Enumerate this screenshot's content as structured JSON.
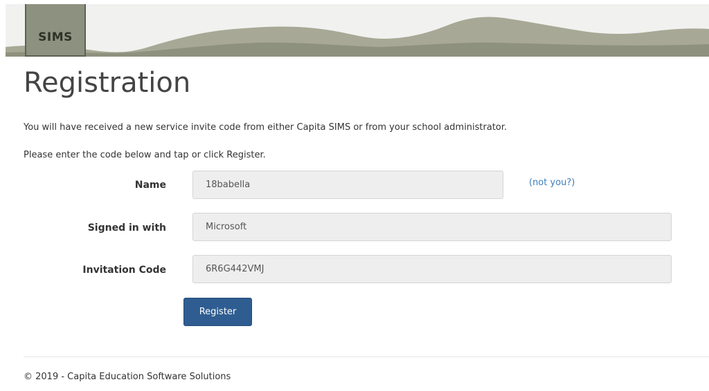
{
  "banner": {
    "logo_text": "SIMS"
  },
  "page": {
    "title": "Registration",
    "intro_line_1": "You will have received a new service invite code from either Capita SIMS or from your school administrator.",
    "intro_line_2": "Please enter the code below and tap or click Register."
  },
  "form": {
    "name": {
      "label": "Name",
      "value": "18babella",
      "not_you_link": "(not you?)"
    },
    "signed_in_with": {
      "label": "Signed in with",
      "value": "Microsoft"
    },
    "invitation_code": {
      "label": "Invitation Code",
      "value": "6R6G442VMJ"
    },
    "register_label": "Register"
  },
  "footer": {
    "copyright": "© 2019 - Capita Education Software Solutions"
  },
  "colors": {
    "primary_button": "#2f5d91",
    "link": "#3d7dbe",
    "banner_logo": "#8d917f",
    "mountain": "#9ea08f"
  }
}
